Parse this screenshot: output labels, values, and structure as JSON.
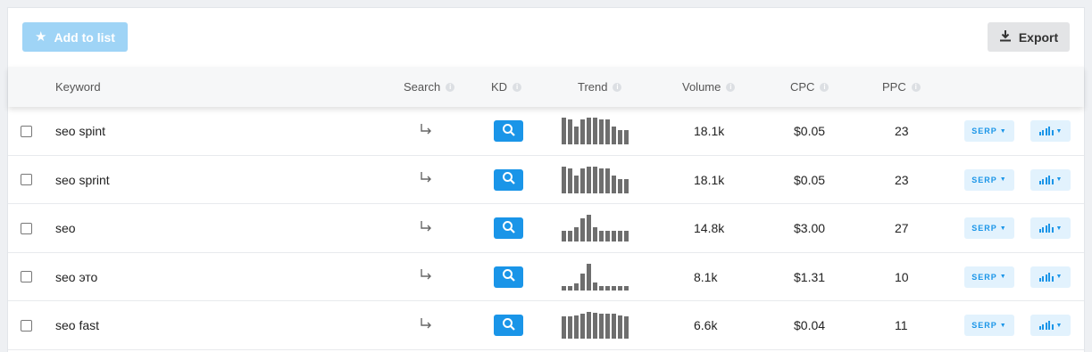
{
  "toolbar": {
    "add_label": "Add to list",
    "export_label": "Export"
  },
  "columns": {
    "keyword": "Keyword",
    "search": "Search",
    "kd": "KD",
    "trend": "Trend",
    "volume": "Volume",
    "cpc": "CPC",
    "ppc": "PPC"
  },
  "serp_label": "SERP",
  "colors": {
    "accent": "#1a95e8",
    "add_button": "#9fd4f6",
    "trend_bar": "#6e6e6e"
  },
  "rows": [
    {
      "keyword": "seo spint",
      "volume": "18.1k",
      "cpc": "$0.05",
      "ppc": "23",
      "trend": [
        1.0,
        0.93,
        0.67,
        0.93,
        1.0,
        1.0,
        0.93,
        0.93,
        0.67,
        0.53,
        0.53
      ]
    },
    {
      "keyword": "seo sprint",
      "volume": "18.1k",
      "cpc": "$0.05",
      "ppc": "23",
      "trend": [
        1.0,
        0.93,
        0.67,
        0.93,
        1.0,
        1.0,
        0.93,
        0.93,
        0.67,
        0.53,
        0.53
      ]
    },
    {
      "keyword": "seo",
      "volume": "14.8k",
      "cpc": "$3.00",
      "ppc": "27",
      "trend": [
        0.4,
        0.4,
        0.53,
        0.87,
        1.0,
        0.53,
        0.4,
        0.4,
        0.4,
        0.4,
        0.4
      ]
    },
    {
      "keyword": "seo это",
      "volume": "8.1k",
      "cpc": "$1.31",
      "ppc": "10",
      "trend": [
        0.17,
        0.17,
        0.27,
        0.63,
        1.0,
        0.3,
        0.17,
        0.17,
        0.17,
        0.17,
        0.17
      ]
    },
    {
      "keyword": "seo fast",
      "volume": "6.6k",
      "cpc": "$0.04",
      "ppc": "11",
      "trend": [
        0.83,
        0.83,
        0.87,
        0.93,
        1.0,
        0.97,
        0.93,
        0.93,
        0.93,
        0.87,
        0.83
      ]
    }
  ]
}
